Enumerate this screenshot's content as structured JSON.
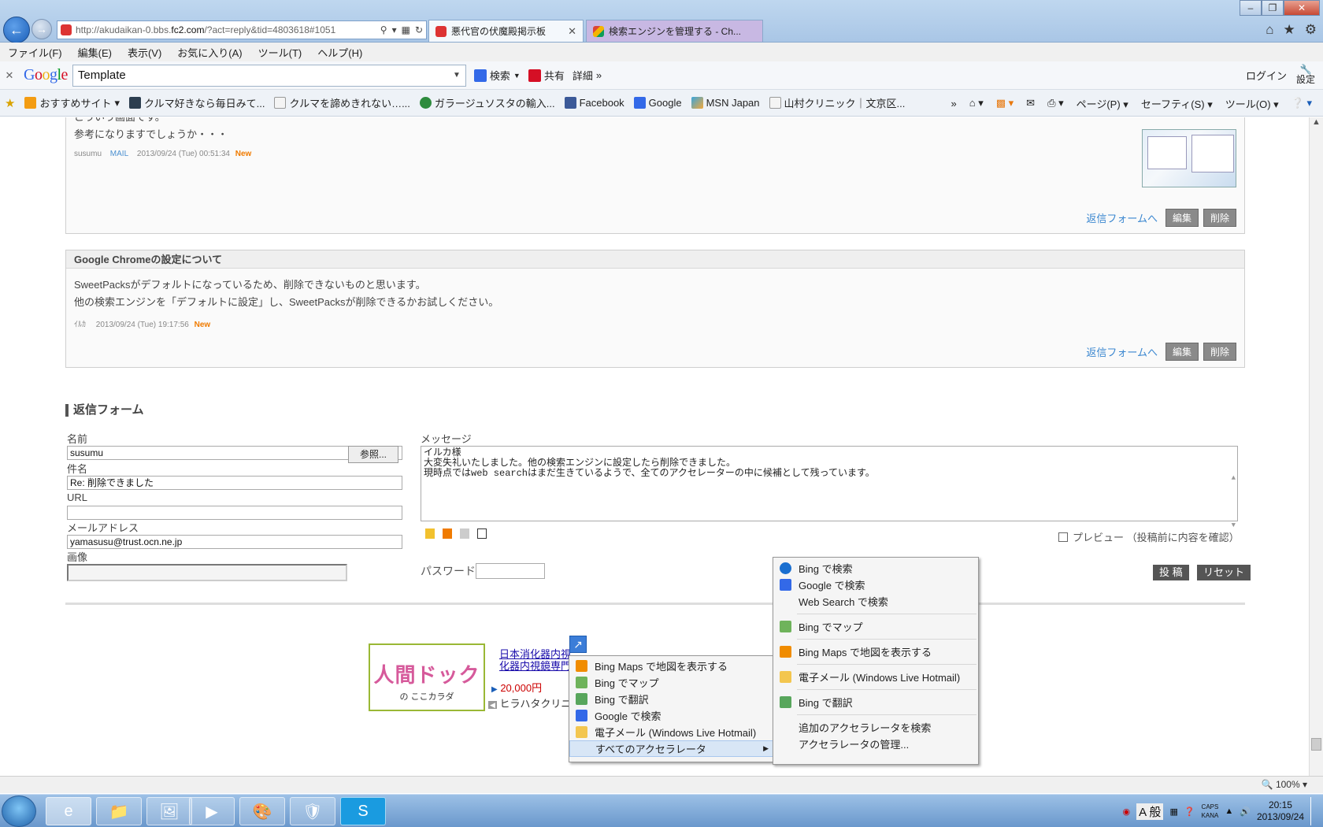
{
  "browser": {
    "url_prefix": "http://akudaikan-0.bbs.",
    "url_domain": "fc2.com",
    "url_suffix": "/?act=reply&tid=4803618#1051",
    "tabs": [
      {
        "label": "悪代官の伏魔殿掲示板"
      },
      {
        "label": "検索エンジンを管理する - Ch..."
      }
    ],
    "menu": [
      "ファイル(F)",
      "編集(E)",
      "表示(V)",
      "お気に入り(A)",
      "ツール(T)",
      "ヘルプ(H)"
    ],
    "google_bar": {
      "search_value": "Template",
      "search_label": "検索",
      "share_label": "共有",
      "more_label": "詳細",
      "login_label": "ログイン",
      "settings_label": "設定"
    },
    "favorites": [
      {
        "label": "おすすめサイト",
        "icon": "star-icon"
      },
      {
        "label": "クルマ好きなら毎日みて...",
        "icon": "car-icon"
      },
      {
        "label": "クルマを諦めきれない…...",
        "icon": "page-icon"
      },
      {
        "label": "ガラージュソスタの輸入...",
        "icon": "leaf-icon"
      },
      {
        "label": "Facebook",
        "icon": "facebook-icon"
      },
      {
        "label": "Google",
        "icon": "google-icon"
      },
      {
        "label": "MSN Japan",
        "icon": "msn-icon"
      },
      {
        "label": "山村クリニック｜文京区...",
        "icon": "page-icon"
      }
    ],
    "command_bar": [
      "ページ(P)",
      "セーフティ(S)",
      "ツール(O)"
    ],
    "zoom": "100%",
    "colors": {
      "accent": "#1a5eb8",
      "link": "#3b87d0",
      "new_badge": "#f07b00"
    }
  },
  "posts": [
    {
      "body": [
        "こういう画面です。",
        "参考になりますでしょうか・・・"
      ],
      "author": "susumu",
      "mail": "MAIL",
      "date": "2013/09/24 (Tue) 00:51:34",
      "new": "New",
      "reply": "返信フォームへ",
      "edit": "編集",
      "delete": "削除"
    },
    {
      "title": "Google Chromeの設定について",
      "body": [
        "SweetPacksがデフォルトになっているため、削除できないものと思います。",
        "他の検索エンジンを「デフォルトに設定」し、SweetPacksが削除できるかお試しください。"
      ],
      "author": "ｲﾙｶ",
      "date": "2013/09/24 (Tue) 19:17:56",
      "new": "New",
      "reply": "返信フォームへ",
      "edit": "編集",
      "delete": "削除"
    }
  ],
  "form": {
    "heading": "返信フォーム",
    "name_label": "名前",
    "name_value": "susumu",
    "subject_label": "件名",
    "subject_value": "Re: 削除できました",
    "url_label": "URL",
    "url_value": "",
    "email_label": "メールアドレス",
    "email_value": "yamasusu@trust.ocn.ne.jp",
    "image_label": "画像",
    "browse_label": "参照...",
    "message_label": "メッセージ",
    "message_lines": [
      "イルカ様",
      "大変失礼いたしました。他の検索エンジンに設定したら削除できました。",
      "現時点ではweb searchはまだ生きているようで、全てのアクセレーターの中に候補として残っています。"
    ],
    "preview_label": "プレビュー （投稿前に内容を確認）",
    "password_label": "パスワード",
    "submit_label": "投 稿",
    "reset_label": "リセット"
  },
  "ad": {
    "logo": "人間ドック",
    "logo_sub": "の ここカラダ",
    "line1": "日本消化器内視",
    "line2": "化器内視鏡専門",
    "price": "20,000円",
    "clinic": "ヒラハタクリニ"
  },
  "accelerator_menu": {
    "items": [
      {
        "label": "Bing Maps で地図を表示する",
        "icon": "bing-icon"
      },
      {
        "label": "Bing でマップ",
        "icon": "map-icon"
      },
      {
        "label": "Bing で翻訳",
        "icon": "translate-icon"
      },
      {
        "label": "Google で検索",
        "icon": "google-icon"
      },
      {
        "label": "電子メール (Windows Live Hotmail)",
        "icon": "mail-icon"
      }
    ],
    "all_label": "すべてのアクセラレータ"
  },
  "submenu": {
    "group1": [
      {
        "label": "Bing で検索",
        "icon": "bing-icon"
      },
      {
        "label": "Google で検索",
        "icon": "google-icon"
      },
      {
        "label": "Web Search で検索",
        "icon": ""
      }
    ],
    "group2": [
      {
        "label": "Bing でマップ",
        "icon": "map-icon"
      }
    ],
    "group3": [
      {
        "label": "Bing Maps で地図を表示する",
        "icon": "bing-icon"
      }
    ],
    "group4": [
      {
        "label": "電子メール (Windows Live Hotmail)",
        "icon": "mail-icon"
      }
    ],
    "group5": [
      {
        "label": "Bing で翻訳",
        "icon": "translate-icon"
      }
    ],
    "find_more": "追加のアクセラレータを検索",
    "manage": "アクセラレータの管理..."
  },
  "taskbar": {
    "time": "20:15",
    "date": "2013/09/24",
    "ime": "A 般",
    "caps": "CAPS",
    "kana": "KANA"
  }
}
